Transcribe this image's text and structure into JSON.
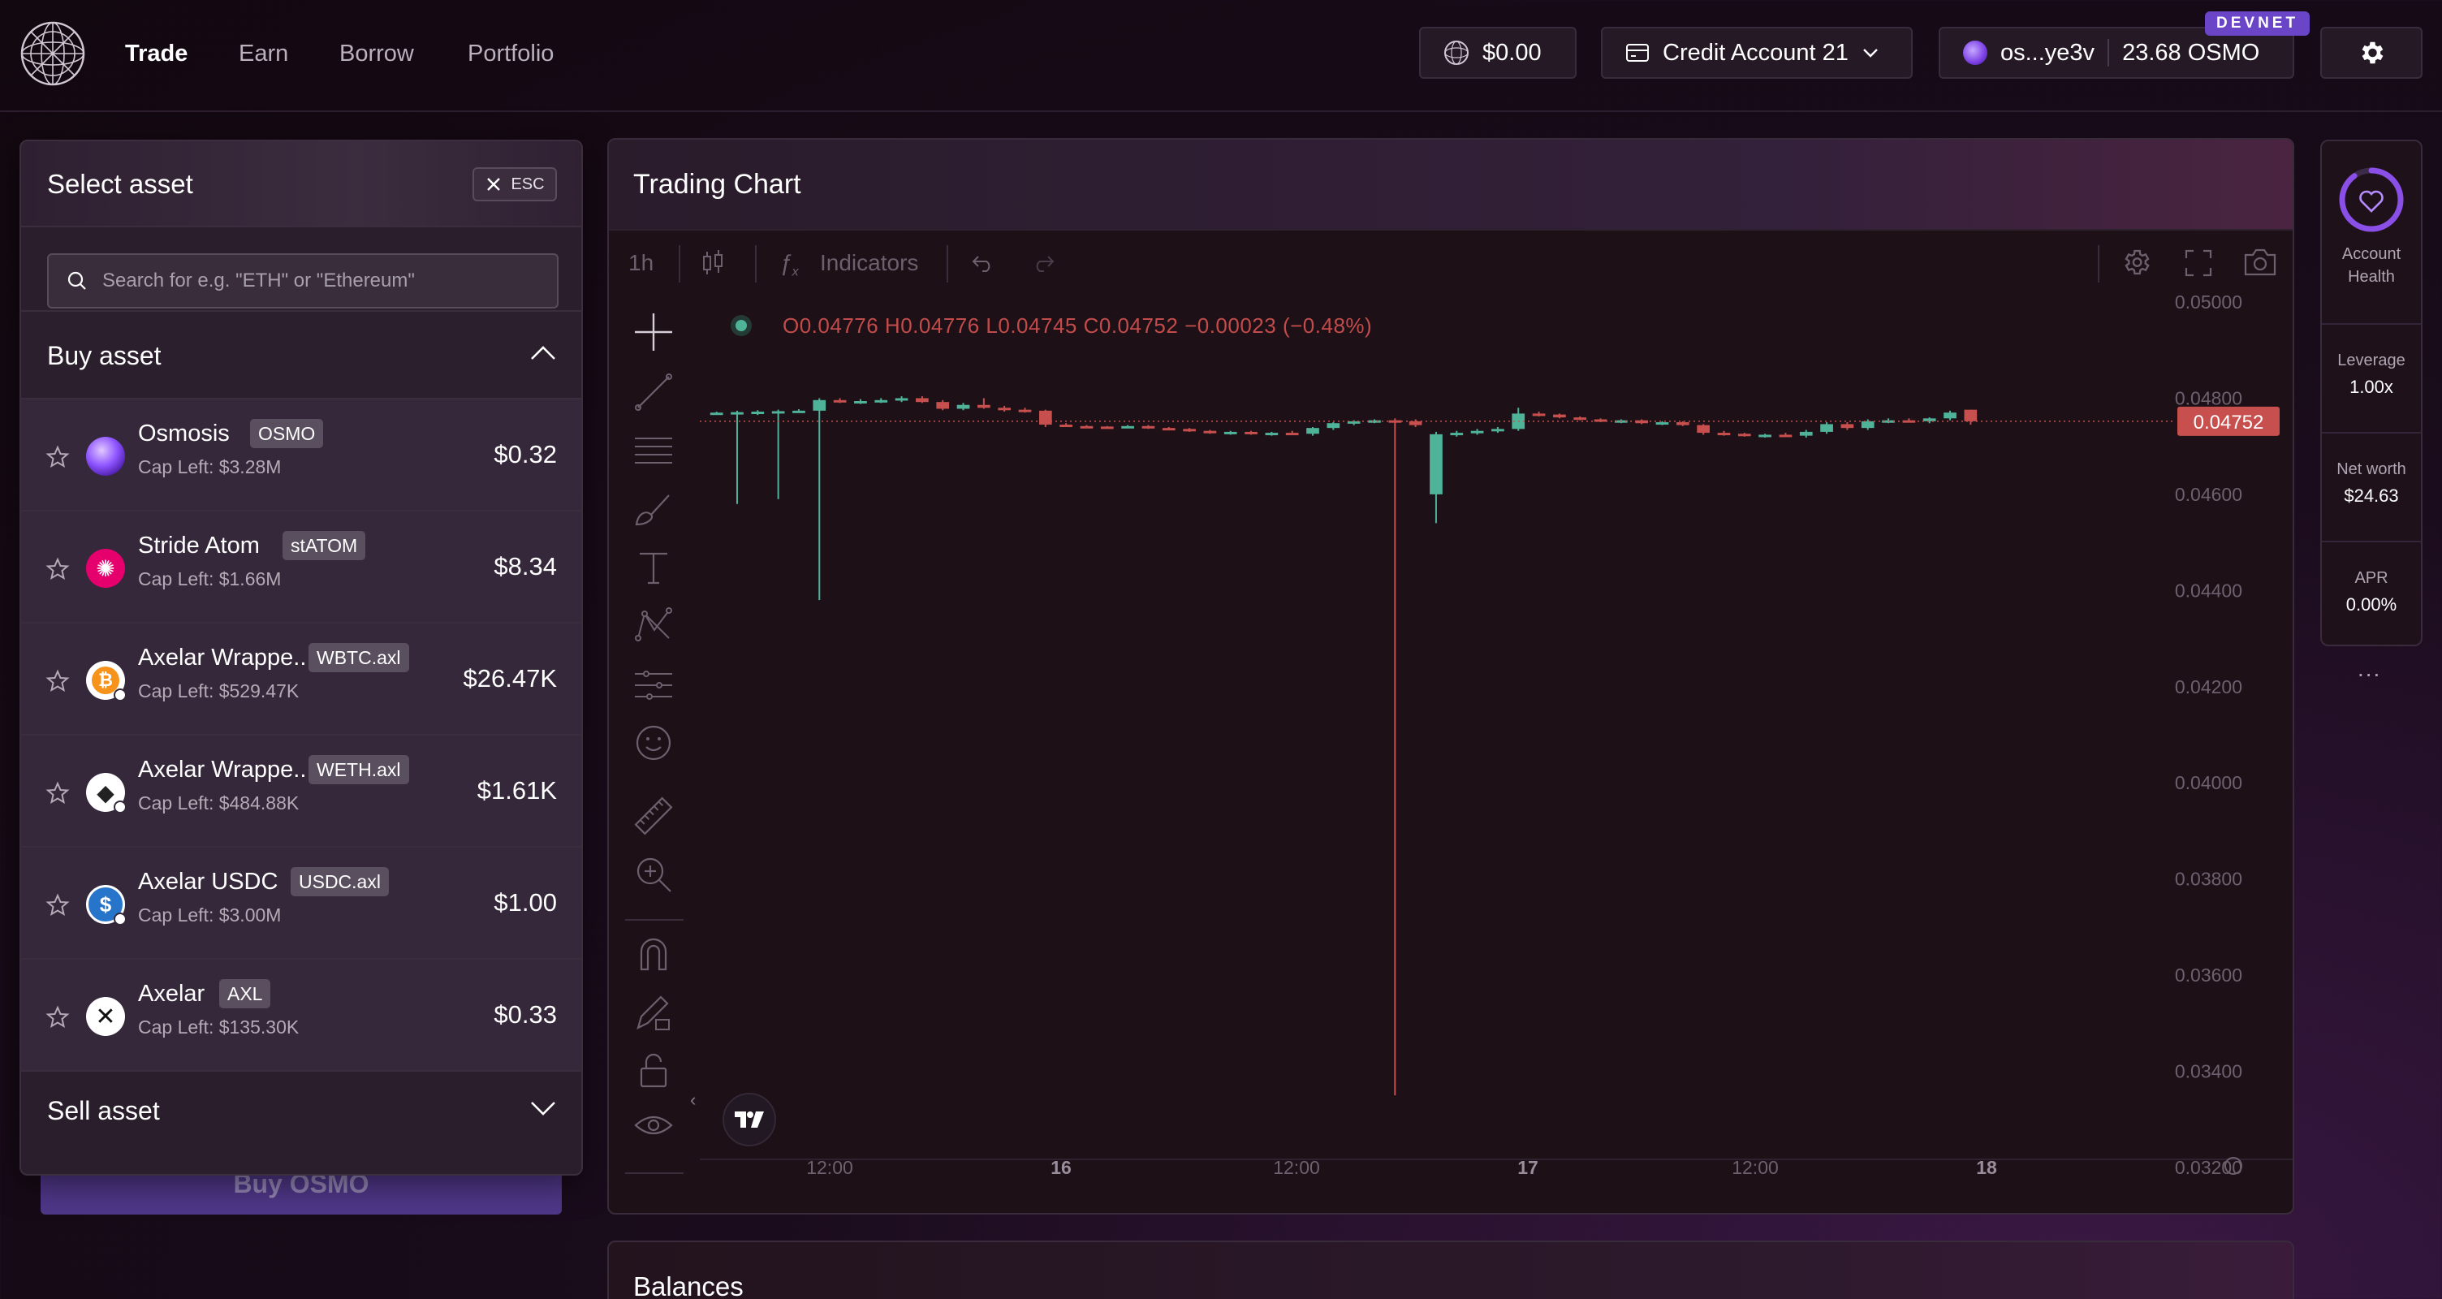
{
  "nav": {
    "items": [
      {
        "label": "Trade",
        "active": true
      },
      {
        "label": "Earn",
        "active": false
      },
      {
        "label": "Borrow",
        "active": false
      },
      {
        "label": "Portfolio",
        "active": false
      }
    ]
  },
  "header": {
    "balance": "$0.00",
    "credit_account": "Credit Account 21",
    "wallet_address": "os...ye3v",
    "wallet_balance": "23.68 OSMO",
    "network_badge": "DEVNET"
  },
  "select_asset": {
    "title": "Select asset",
    "esc_label": "ESC",
    "search_placeholder": "Search for e.g. \"ETH\" or \"Ethereum\"",
    "buy_section_title": "Buy asset",
    "sell_section_title": "Sell asset",
    "assets": [
      {
        "name": "Osmosis",
        "symbol": "OSMO",
        "cap": "Cap Left: $3.28M",
        "price": "$0.32",
        "icon": "osmosis-icon",
        "color": "#7b3fe4"
      },
      {
        "name": "Stride Atom",
        "symbol": "stATOM",
        "cap": "Cap Left: $1.66M",
        "price": "$8.34",
        "icon": "stride-atom-icon",
        "color": "#e5006e"
      },
      {
        "name": "Axelar Wrappe...",
        "symbol": "WBTC.axl",
        "cap": "Cap Left: $529.47K",
        "price": "$26.47K",
        "icon": "wbtc-icon",
        "color": "#f7931a"
      },
      {
        "name": "Axelar Wrappe...",
        "symbol": "WETH.axl",
        "cap": "Cap Left: $484.88K",
        "price": "$1.61K",
        "icon": "weth-icon",
        "color": "#ffffff"
      },
      {
        "name": "Axelar USDC",
        "symbol": "USDC.axl",
        "cap": "Cap Left: $3.00M",
        "price": "$1.00",
        "icon": "usdc-icon",
        "color": "#2775ca"
      },
      {
        "name": "Axelar",
        "symbol": "AXL",
        "cap": "Cap Left: $135.30K",
        "price": "$0.33",
        "icon": "axelar-icon",
        "color": "#ffffff"
      }
    ],
    "buy_button": "Buy OSMO"
  },
  "chart": {
    "title": "Trading Chart",
    "interval": "1h",
    "indicators_label": "Indicators",
    "ohlc": "O0.04776 H0.04776 L0.04745 C0.04752 −0.00023 (−0.48%)",
    "last_price": "0.04752",
    "y_ticks": [
      "0.05000",
      "0.04800",
      "0.04600",
      "0.04400",
      "0.04200",
      "0.04000",
      "0.03800",
      "0.03600",
      "0.03400",
      "0.03200"
    ],
    "x_ticks": [
      "12:00",
      "16",
      "12:00",
      "17",
      "12:00",
      "18"
    ],
    "colors": {
      "up": "#4fb39a",
      "down": "#c7504e"
    }
  },
  "chart_data": {
    "type": "candlestick",
    "title": "",
    "ylim": [
      0.032,
      0.05
    ],
    "last_close": 0.04752,
    "x_ticks": [
      "12:00",
      "16",
      "12:00",
      "17",
      "12:00",
      "18"
    ],
    "candles": [
      {
        "o": 0.04768,
        "h": 0.04772,
        "l": 0.04766,
        "c": 0.0477
      },
      {
        "o": 0.0477,
        "h": 0.04774,
        "l": 0.0458,
        "c": 0.04771
      },
      {
        "o": 0.04771,
        "h": 0.04775,
        "l": 0.04765,
        "c": 0.04772
      },
      {
        "o": 0.04772,
        "h": 0.04776,
        "l": 0.0459,
        "c": 0.04773
      },
      {
        "o": 0.04773,
        "h": 0.04777,
        "l": 0.0477,
        "c": 0.04774
      },
      {
        "o": 0.04774,
        "h": 0.048,
        "l": 0.0438,
        "c": 0.04796
      },
      {
        "o": 0.04796,
        "h": 0.048,
        "l": 0.0479,
        "c": 0.04792
      },
      {
        "o": 0.04792,
        "h": 0.04798,
        "l": 0.04788,
        "c": 0.04794
      },
      {
        "o": 0.04794,
        "h": 0.048,
        "l": 0.0479,
        "c": 0.04796
      },
      {
        "o": 0.04796,
        "h": 0.04804,
        "l": 0.04792,
        "c": 0.048
      },
      {
        "o": 0.048,
        "h": 0.04804,
        "l": 0.0479,
        "c": 0.04792
      },
      {
        "o": 0.04792,
        "h": 0.04796,
        "l": 0.04775,
        "c": 0.04778
      },
      {
        "o": 0.04778,
        "h": 0.0479,
        "l": 0.04775,
        "c": 0.04786
      },
      {
        "o": 0.04786,
        "h": 0.048,
        "l": 0.04778,
        "c": 0.0478
      },
      {
        "o": 0.0478,
        "h": 0.04784,
        "l": 0.04772,
        "c": 0.04776
      },
      {
        "o": 0.04776,
        "h": 0.0478,
        "l": 0.0477,
        "c": 0.04774
      },
      {
        "o": 0.04774,
        "h": 0.04776,
        "l": 0.0474,
        "c": 0.04745
      },
      {
        "o": 0.04745,
        "h": 0.04748,
        "l": 0.0474,
        "c": 0.04742
      },
      {
        "o": 0.04742,
        "h": 0.04744,
        "l": 0.0474,
        "c": 0.04741
      },
      {
        "o": 0.04741,
        "h": 0.04742,
        "l": 0.04738,
        "c": 0.0474
      },
      {
        "o": 0.0474,
        "h": 0.04744,
        "l": 0.04738,
        "c": 0.04742
      },
      {
        "o": 0.04742,
        "h": 0.04744,
        "l": 0.04736,
        "c": 0.04738
      },
      {
        "o": 0.04738,
        "h": 0.0474,
        "l": 0.04734,
        "c": 0.04736
      },
      {
        "o": 0.04736,
        "h": 0.04738,
        "l": 0.0473,
        "c": 0.04732
      },
      {
        "o": 0.04732,
        "h": 0.04734,
        "l": 0.04726,
        "c": 0.04728
      },
      {
        "o": 0.04728,
        "h": 0.04732,
        "l": 0.04724,
        "c": 0.0473
      },
      {
        "o": 0.0473,
        "h": 0.04732,
        "l": 0.04724,
        "c": 0.04726
      },
      {
        "o": 0.04726,
        "h": 0.0473,
        "l": 0.04722,
        "c": 0.04728
      },
      {
        "o": 0.04728,
        "h": 0.04732,
        "l": 0.04724,
        "c": 0.04726
      },
      {
        "o": 0.04726,
        "h": 0.0474,
        "l": 0.04722,
        "c": 0.04738
      },
      {
        "o": 0.04738,
        "h": 0.0475,
        "l": 0.04734,
        "c": 0.04748
      },
      {
        "o": 0.04748,
        "h": 0.04754,
        "l": 0.04744,
        "c": 0.04752
      },
      {
        "o": 0.04752,
        "h": 0.04756,
        "l": 0.04748,
        "c": 0.04754
      },
      {
        "o": 0.04754,
        "h": 0.04758,
        "l": 0.0335,
        "c": 0.04752
      },
      {
        "o": 0.04752,
        "h": 0.04756,
        "l": 0.0474,
        "c": 0.04744
      },
      {
        "o": 0.046,
        "h": 0.0473,
        "l": 0.0454,
        "c": 0.04725
      },
      {
        "o": 0.04725,
        "h": 0.04732,
        "l": 0.0472,
        "c": 0.04728
      },
      {
        "o": 0.04728,
        "h": 0.04736,
        "l": 0.04724,
        "c": 0.04732
      },
      {
        "o": 0.04732,
        "h": 0.0474,
        "l": 0.04728,
        "c": 0.04736
      },
      {
        "o": 0.04736,
        "h": 0.0478,
        "l": 0.04732,
        "c": 0.04768
      },
      {
        "o": 0.04768,
        "h": 0.04772,
        "l": 0.04762,
        "c": 0.04766
      },
      {
        "o": 0.04766,
        "h": 0.04768,
        "l": 0.04758,
        "c": 0.0476
      },
      {
        "o": 0.0476,
        "h": 0.04762,
        "l": 0.04754,
        "c": 0.04756
      },
      {
        "o": 0.04756,
        "h": 0.04758,
        "l": 0.0475,
        "c": 0.04752
      },
      {
        "o": 0.04752,
        "h": 0.04756,
        "l": 0.04748,
        "c": 0.04754
      },
      {
        "o": 0.04754,
        "h": 0.04756,
        "l": 0.04746,
        "c": 0.04748
      },
      {
        "o": 0.04748,
        "h": 0.04752,
        "l": 0.04744,
        "c": 0.0475
      },
      {
        "o": 0.0475,
        "h": 0.04752,
        "l": 0.04742,
        "c": 0.04744
      },
      {
        "o": 0.04744,
        "h": 0.04746,
        "l": 0.04724,
        "c": 0.04728
      },
      {
        "o": 0.04728,
        "h": 0.04732,
        "l": 0.04722,
        "c": 0.04726
      },
      {
        "o": 0.04726,
        "h": 0.04728,
        "l": 0.0472,
        "c": 0.04722
      },
      {
        "o": 0.04722,
        "h": 0.04726,
        "l": 0.04718,
        "c": 0.04724
      },
      {
        "o": 0.04724,
        "h": 0.04728,
        "l": 0.0472,
        "c": 0.04722
      },
      {
        "o": 0.04722,
        "h": 0.04734,
        "l": 0.04718,
        "c": 0.0473
      },
      {
        "o": 0.0473,
        "h": 0.0475,
        "l": 0.04726,
        "c": 0.04746
      },
      {
        "o": 0.04746,
        "h": 0.0475,
        "l": 0.04734,
        "c": 0.04738
      },
      {
        "o": 0.04738,
        "h": 0.04756,
        "l": 0.04734,
        "c": 0.04752
      },
      {
        "o": 0.04752,
        "h": 0.04758,
        "l": 0.04748,
        "c": 0.04754
      },
      {
        "o": 0.04754,
        "h": 0.04758,
        "l": 0.0475,
        "c": 0.04752
      },
      {
        "o": 0.04752,
        "h": 0.0476,
        "l": 0.04748,
        "c": 0.04758
      },
      {
        "o": 0.04758,
        "h": 0.04774,
        "l": 0.04754,
        "c": 0.0477
      },
      {
        "o": 0.04776,
        "h": 0.04776,
        "l": 0.04745,
        "c": 0.04752
      }
    ]
  },
  "sidebar": {
    "account_health_label": "Account Health",
    "health_percent": 0.9,
    "leverage_label": "Leverage",
    "leverage_value": "1.00x",
    "net_worth_label": "Net worth",
    "net_worth_value": "$24.63",
    "apr_label": "APR",
    "apr_value": "0.00%",
    "more": "..."
  },
  "balances": {
    "title": "Balances"
  }
}
